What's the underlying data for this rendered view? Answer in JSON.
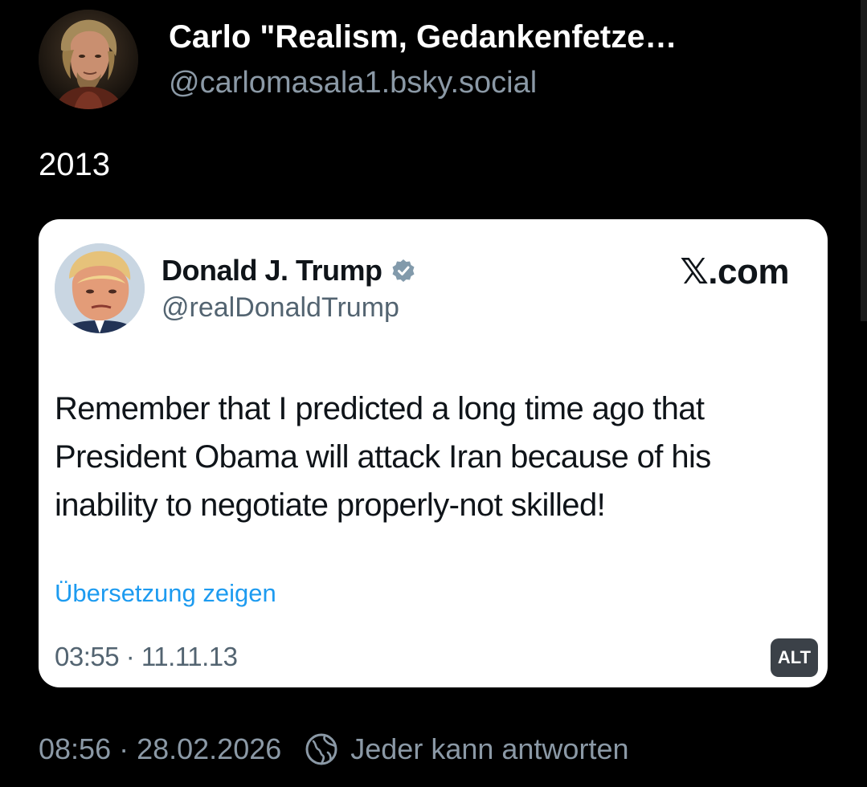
{
  "post": {
    "author": {
      "display_name": "Carlo \"Realism, Gedankenfetze…",
      "handle": "@carlomasala1.bsky.social"
    },
    "text": "2013",
    "embed": {
      "author_name": "Donald J. Trump",
      "author_handle": "@realDonaldTrump",
      "brand": "𝕏.com",
      "body_lines": [
        "Remember that I predicted a long time ago that",
        "President Obama will attack Iran because of his",
        "inability to negotiate properly-not skilled!"
      ],
      "translate_label": "Übersetzung zeigen",
      "timestamp": "03:55 · 11.11.13",
      "alt_badge": "ALT"
    },
    "footer": {
      "timestamp": "08:56 · 28.02.2026",
      "reply_setting": "Jeder kann antworten"
    }
  },
  "colors": {
    "background": "#000000",
    "muted_text": "#8b99a6",
    "link_blue": "#1d9bf0",
    "card_background": "#ffffff"
  },
  "icons": {
    "verified": "verified-badge-icon",
    "reply_setting": "globe-icon"
  }
}
